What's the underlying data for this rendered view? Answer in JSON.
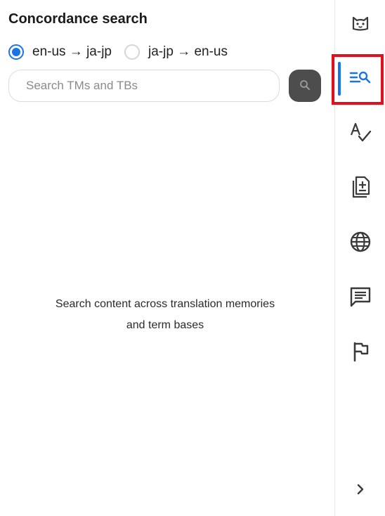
{
  "panel": {
    "title": "Concordance search",
    "directions": [
      {
        "label": "en-us → ja-jp",
        "selected": true
      },
      {
        "label": "ja-jp → en-us",
        "selected": false
      }
    ],
    "search": {
      "placeholder": "Search TMs and TBs",
      "value": ""
    },
    "empty_message": {
      "line1": "Search content across translation memories",
      "line2": "and term bases"
    }
  },
  "sidebar": {
    "items": [
      {
        "icon": "cat-icon",
        "active": false
      },
      {
        "icon": "concordance-search-icon",
        "active": true
      },
      {
        "icon": "spellcheck-icon",
        "active": false
      },
      {
        "icon": "add-document-icon",
        "active": false
      },
      {
        "icon": "globe-icon",
        "active": false
      },
      {
        "icon": "comment-icon",
        "active": false
      },
      {
        "icon": "flag-icon",
        "active": false
      }
    ],
    "expand_icon": "chevron-right-icon"
  },
  "colors": {
    "accent": "#1a73e8",
    "search_button": "#4d4d4d",
    "highlight": "#e0101c"
  }
}
